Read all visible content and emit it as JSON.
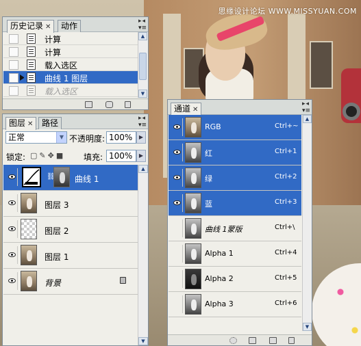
{
  "watermark": "思缘设计论坛 WWW.MISSYUAN.COM",
  "history_panel": {
    "tabs": [
      {
        "label": "历史记录",
        "active": true
      },
      {
        "label": "动作",
        "active": false
      }
    ],
    "items": [
      {
        "label": "计算",
        "state": "normal"
      },
      {
        "label": "计算",
        "state": "normal"
      },
      {
        "label": "载入选区",
        "state": "normal"
      },
      {
        "label": "曲线 1 图层",
        "state": "selected"
      },
      {
        "label": "载入选区",
        "state": "dim"
      }
    ],
    "footer_icons": [
      "new-document-icon",
      "camera-icon",
      "trash-icon"
    ]
  },
  "layers_panel": {
    "tabs": [
      {
        "label": "图层",
        "active": true
      },
      {
        "label": "路径",
        "active": false
      }
    ],
    "blend_mode": "正常",
    "opacity_label": "不透明度:",
    "opacity_value": "100%",
    "lock_label": "锁定:",
    "fill_label": "填充:",
    "fill_value": "100%",
    "layers": [
      {
        "name": "曲线 1",
        "type": "adjustment",
        "selected": true
      },
      {
        "name": "图层 3",
        "type": "image",
        "selected": false
      },
      {
        "name": "图层 2",
        "type": "transparent",
        "selected": false
      },
      {
        "name": "图层 1",
        "type": "image",
        "selected": false
      },
      {
        "name": "背景",
        "type": "background",
        "selected": false,
        "locked": true
      }
    ]
  },
  "channels_panel": {
    "tabs": [
      {
        "label": "通道",
        "active": true
      }
    ],
    "channels": [
      {
        "name": "RGB",
        "shortcut": "Ctrl+~",
        "selected": true,
        "visible": true
      },
      {
        "name": "红",
        "shortcut": "Ctrl+1",
        "selected": true,
        "visible": true
      },
      {
        "name": "绿",
        "shortcut": "Ctrl+2",
        "selected": true,
        "visible": true
      },
      {
        "name": "蓝",
        "shortcut": "Ctrl+3",
        "selected": true,
        "visible": true
      },
      {
        "name": "曲线 1蒙版",
        "shortcut": "Ctrl+\\",
        "selected": false,
        "visible": false
      },
      {
        "name": "Alpha 1",
        "shortcut": "Ctrl+4",
        "selected": false,
        "visible": false
      },
      {
        "name": "Alpha 2",
        "shortcut": "Ctrl+5",
        "selected": false,
        "visible": false
      },
      {
        "name": "Alpha 3",
        "shortcut": "Ctrl+6",
        "selected": false,
        "visible": false
      }
    ],
    "footer_icons": [
      "dotted-circle-icon",
      "save-selection-icon",
      "new-channel-icon",
      "trash-icon"
    ]
  },
  "colors": {
    "selection": "#316ac5",
    "panel_bg": "#f0efe9",
    "tab_bar": "#d8dcd9"
  }
}
